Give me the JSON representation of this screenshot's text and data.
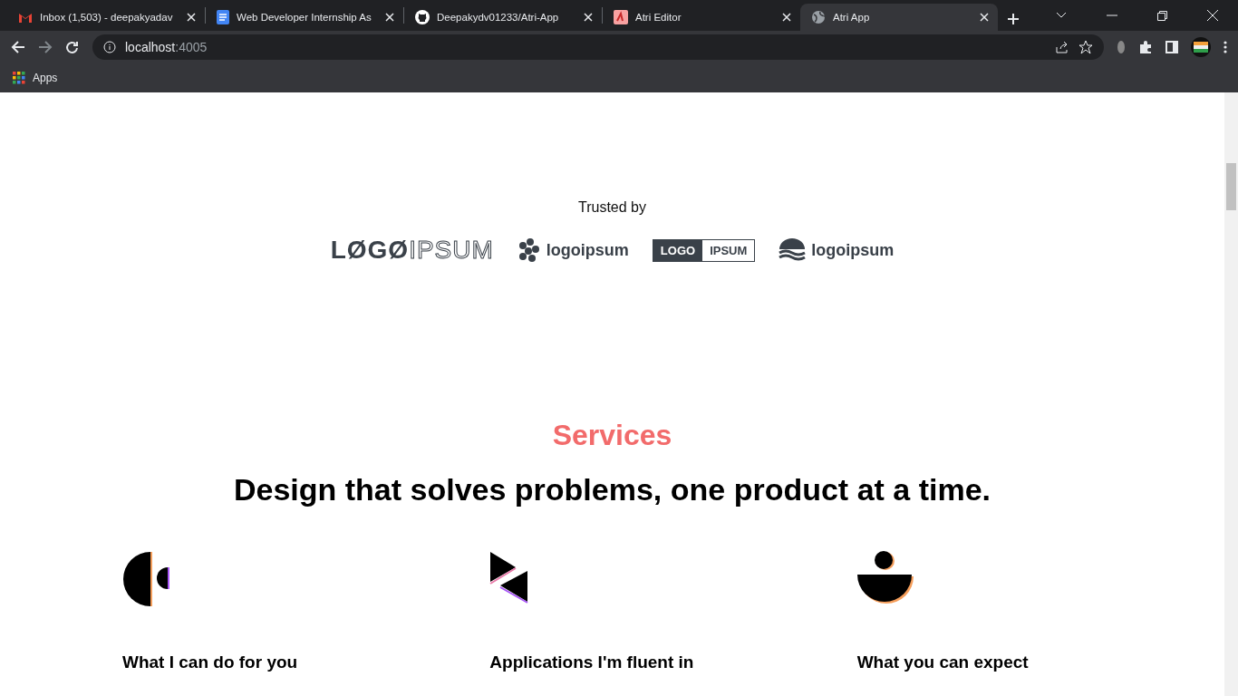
{
  "browser": {
    "tabs": [
      {
        "kind": "gmail",
        "title": "Inbox (1,503) - deepakyadav",
        "selected": false
      },
      {
        "kind": "docs",
        "title": "Web Developer Internship As",
        "selected": false
      },
      {
        "kind": "github",
        "title": "Deepakydv01233/Atri-App",
        "selected": false
      },
      {
        "kind": "atri",
        "title": "Atri Editor",
        "selected": false
      },
      {
        "kind": "globe",
        "title": "Atri App",
        "selected": true
      }
    ],
    "address": {
      "host": "localhost",
      "port": ":4005"
    },
    "bookmarks": [
      {
        "label": "Apps"
      }
    ]
  },
  "trusted": {
    "label": "Trusted by",
    "logos": [
      {
        "kind": "outline",
        "bold": "LØGØ",
        "light": "IPSUM"
      },
      {
        "kind": "dots",
        "text": "logoipsum"
      },
      {
        "kind": "boxed",
        "left": "LOGO",
        "right": "IPSUM"
      },
      {
        "kind": "waves",
        "text": "logoipsum"
      }
    ]
  },
  "services": {
    "eyebrow": "Services",
    "heading": "Design that solves problems, one product at a time.",
    "cards": [
      {
        "kind": "half-circles",
        "title": "What I can do for you"
      },
      {
        "kind": "triangles",
        "title": "Applications I'm fluent in"
      },
      {
        "kind": "bowl",
        "title": "What you can expect"
      }
    ]
  }
}
